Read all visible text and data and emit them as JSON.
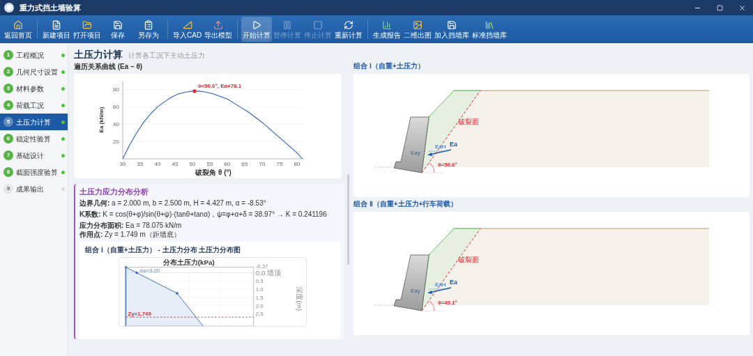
{
  "window": {
    "title": "重力式挡土墙验算"
  },
  "toolbar": [
    [
      {
        "label": "返回首页",
        "active": false,
        "disabled": false
      }
    ],
    [
      {
        "label": "新建项目",
        "active": false,
        "disabled": false
      },
      {
        "label": "打开项目",
        "active": false,
        "disabled": false
      },
      {
        "label": "保存",
        "active": false,
        "disabled": false
      },
      {
        "label": "另存为",
        "active": false,
        "disabled": false
      }
    ],
    [
      {
        "label": "导入CAD",
        "active": false,
        "disabled": false
      },
      {
        "label": "导出模型",
        "active": false,
        "disabled": false
      }
    ],
    [
      {
        "label": "开始计算",
        "active": true,
        "disabled": false
      },
      {
        "label": "暂停计算",
        "active": false,
        "disabled": true
      },
      {
        "label": "停止计算",
        "active": false,
        "disabled": true
      },
      {
        "label": "重新计算",
        "active": false,
        "disabled": false
      }
    ],
    [
      {
        "label": "生成报告",
        "active": false,
        "disabled": false
      },
      {
        "label": "二维出图",
        "active": false,
        "disabled": false
      },
      {
        "label": "加入挡墙库",
        "active": false,
        "disabled": false
      },
      {
        "label": "标准挡墙库",
        "active": false,
        "disabled": false
      }
    ]
  ],
  "sidebar": {
    "items": [
      {
        "number": "1",
        "label": "工程概况",
        "done": true,
        "selected": false
      },
      {
        "number": "2",
        "label": "几何尺寸设置",
        "done": true,
        "selected": false
      },
      {
        "number": "3",
        "label": "材料参数",
        "done": true,
        "selected": false
      },
      {
        "number": "4",
        "label": "荷载工况",
        "done": true,
        "selected": false
      },
      {
        "number": "5",
        "label": "土压力计算",
        "done": true,
        "selected": true
      },
      {
        "number": "6",
        "label": "稳定性验算",
        "done": true,
        "selected": false
      },
      {
        "number": "7",
        "label": "基础设计",
        "done": true,
        "selected": false
      },
      {
        "number": "8",
        "label": "截面强度验算",
        "done": true,
        "selected": false
      },
      {
        "number": "9",
        "label": "成果输出",
        "done": false,
        "selected": false
      }
    ]
  },
  "page": {
    "title": "土压力计算",
    "subtitle": "计算各工况下主动土压力"
  },
  "curve": {
    "heading": "遍历关系曲线 (Ea – θ)",
    "chart_data": {
      "type": "line",
      "xlabel": "破裂角 θ (°)",
      "ylabel": "Ea (kN/m)",
      "grid": true,
      "x": [
        30,
        32,
        34,
        36,
        38,
        40,
        42,
        44,
        46,
        48,
        50,
        50.6,
        52,
        54,
        56,
        58,
        60,
        62,
        64,
        66,
        68,
        70,
        72,
        74,
        76,
        78,
        80,
        81.5
      ],
      "series": [
        {
          "color": "#2563b8",
          "values": [
            0,
            16,
            30,
            42,
            52,
            60,
            66,
            71,
            75,
            77,
            78,
            78,
            78,
            77,
            75,
            72,
            69,
            64,
            59,
            54,
            48,
            42,
            35,
            28,
            21,
            14,
            7,
            0
          ]
        }
      ],
      "xlim": [
        30,
        82
      ],
      "ylim": [
        0,
        90
      ],
      "xticks": [
        30,
        35,
        40,
        45,
        50,
        55,
        60,
        65,
        70,
        75,
        80
      ],
      "yticks": [
        20,
        40,
        60,
        80
      ],
      "annotations": [
        {
          "x": 50.6,
          "y": 78.1,
          "text": "θ=50.6°, Ea=78.1"
        }
      ]
    }
  },
  "analysis": {
    "title": "土压力应力分布分析",
    "lines": [
      "**边界几何:** a = 2.000 m, b = 2.500 m, H = 4.427 m, α = -8.53°",
      "**K系数:** K = cos(θ+φ)/sin(θ+ψ)·(tanθ+tanα)，ψ=φ+α+δ = 38.97° → K = 0.241196"
    ],
    "area": "**应力分布面积:** Ea = 78.075 kN/m",
    "point": "**作用点:** Zy = 1.749 m（距墙底）",
    "distribution": {
      "title": "组合 Ⅰ（自重+土压力） - 土压力分布 土压力分布图",
      "chart_title": "分布土压力(kPa)",
      "depth_labels": [
        "-0.37",
        "0.0 墙顶",
        "0.5",
        "1.0",
        "1.5",
        "2.0",
        "2.5"
      ],
      "axis_label": "深度(m)",
      "sigma_label": "σa=3.20",
      "zy_label": "Zy=1.749"
    }
  },
  "diagrams": [
    {
      "title": "组合 Ⅰ（自重+土压力）",
      "failure_label": "破裂面",
      "theta_label": "θ=50.6°",
      "ea": "Ea",
      "eah": "EaH",
      "eay": "Eay"
    },
    {
      "title": "组合 Ⅱ（自重+土压力+行车荷载）",
      "failure_label": "破裂面",
      "theta_label": "θ=49.1°",
      "ea": "Ea",
      "eah": "EaH",
      "eay": "Eay"
    }
  ]
}
